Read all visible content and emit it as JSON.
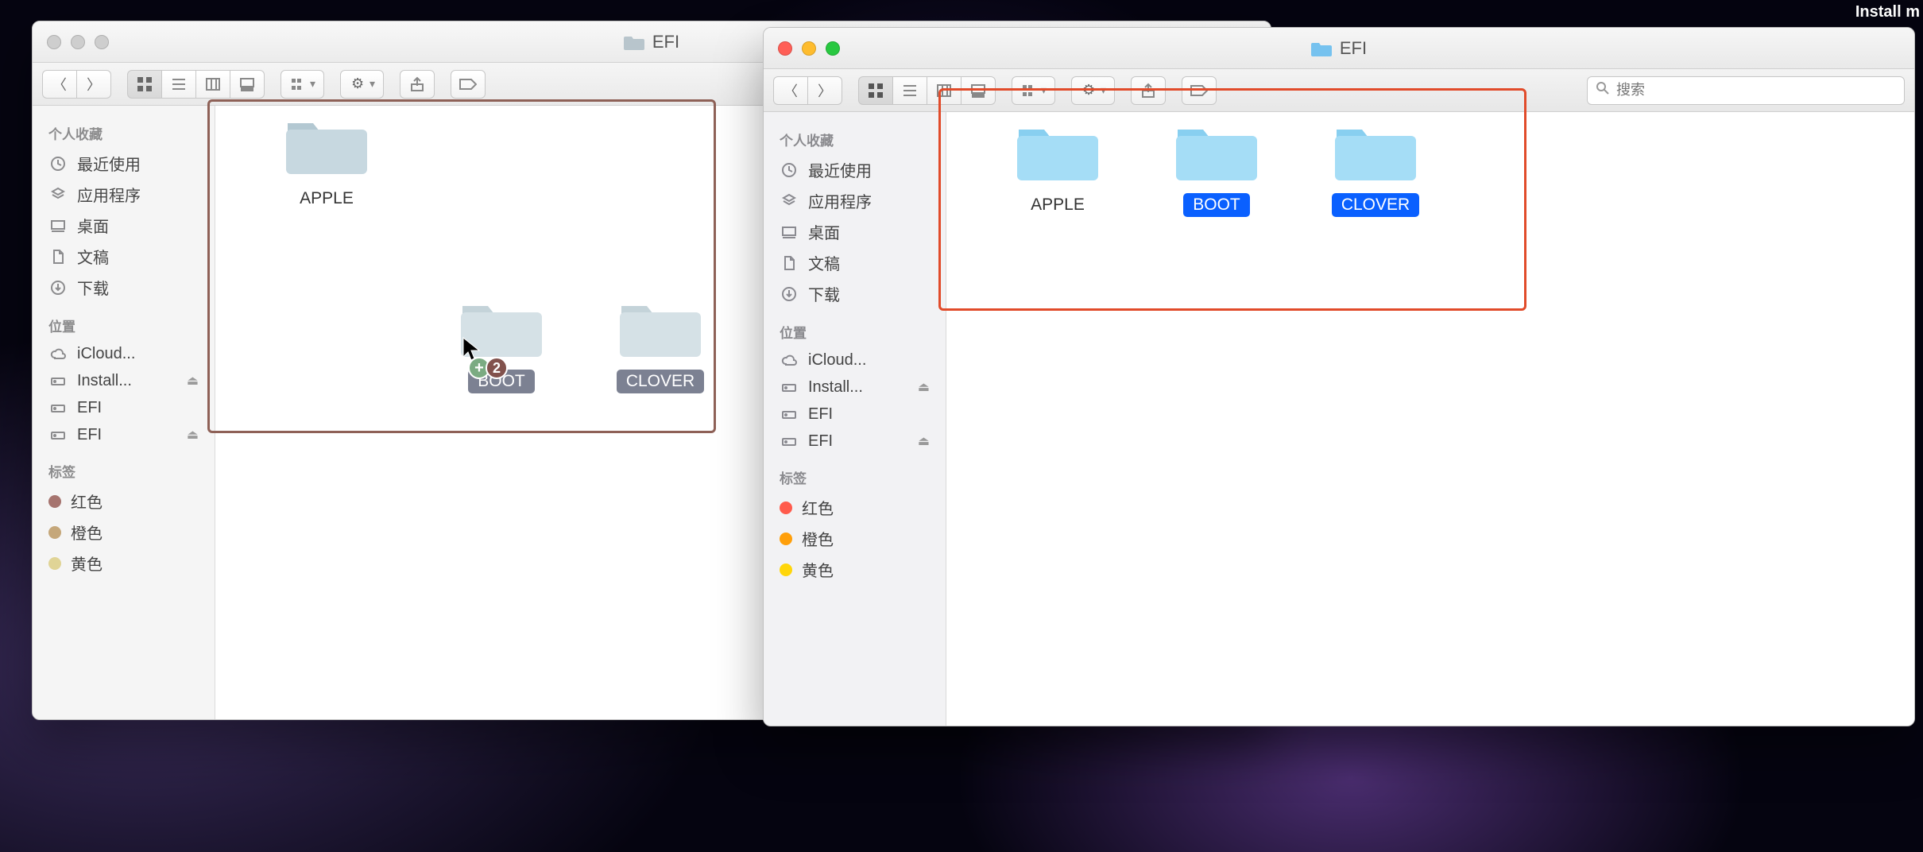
{
  "menubar": {
    "right_app": "Install m"
  },
  "window_inactive": {
    "title": "EFI",
    "sidebar": {
      "favorites_header": "个人收藏",
      "locations_header": "位置",
      "tags_header": "标签",
      "favorites": [
        {
          "icon": "clock",
          "label": "最近使用"
        },
        {
          "icon": "apps",
          "label": "应用程序"
        },
        {
          "icon": "desktop",
          "label": "桌面"
        },
        {
          "icon": "doc",
          "label": "文稿"
        },
        {
          "icon": "download",
          "label": "下载"
        }
      ],
      "locations": [
        {
          "icon": "cloud",
          "label": "iCloud..."
        },
        {
          "icon": "drive",
          "label": "Install...",
          "eject": true
        },
        {
          "icon": "drive",
          "label": "EFI"
        },
        {
          "icon": "drive",
          "label": "EFI",
          "eject": true
        }
      ],
      "tags": [
        {
          "color": "#ff5b4c",
          "label": "红色"
        },
        {
          "color": "#ff9f0a",
          "label": "橙色"
        },
        {
          "color": "#ffd60a",
          "label": "黄色"
        }
      ]
    },
    "folders": [
      {
        "name": "APPLE",
        "selected": false
      },
      {
        "name": "BOOT",
        "selected": true
      },
      {
        "name": "CLOVER",
        "selected": true
      }
    ],
    "drag": {
      "count": "2"
    }
  },
  "window_active": {
    "title": "EFI",
    "search_placeholder": "搜索",
    "sidebar": {
      "favorites_header": "个人收藏",
      "locations_header": "位置",
      "tags_header": "标签",
      "favorites": [
        {
          "icon": "clock",
          "label": "最近使用"
        },
        {
          "icon": "apps",
          "label": "应用程序"
        },
        {
          "icon": "desktop",
          "label": "桌面"
        },
        {
          "icon": "doc",
          "label": "文稿"
        },
        {
          "icon": "download",
          "label": "下载"
        }
      ],
      "locations": [
        {
          "icon": "cloud",
          "label": "iCloud..."
        },
        {
          "icon": "drive",
          "label": "Install...",
          "eject": true
        },
        {
          "icon": "drive",
          "label": "EFI"
        },
        {
          "icon": "drive",
          "label": "EFI",
          "eject": true
        }
      ],
      "tags": [
        {
          "color": "#ff5b4c",
          "label": "红色"
        },
        {
          "color": "#ff9f0a",
          "label": "橙色"
        },
        {
          "color": "#ffd60a",
          "label": "黄色"
        }
      ]
    },
    "folders": [
      {
        "name": "APPLE",
        "selected": false
      },
      {
        "name": "BOOT",
        "selected": true
      },
      {
        "name": "CLOVER",
        "selected": true
      }
    ]
  }
}
